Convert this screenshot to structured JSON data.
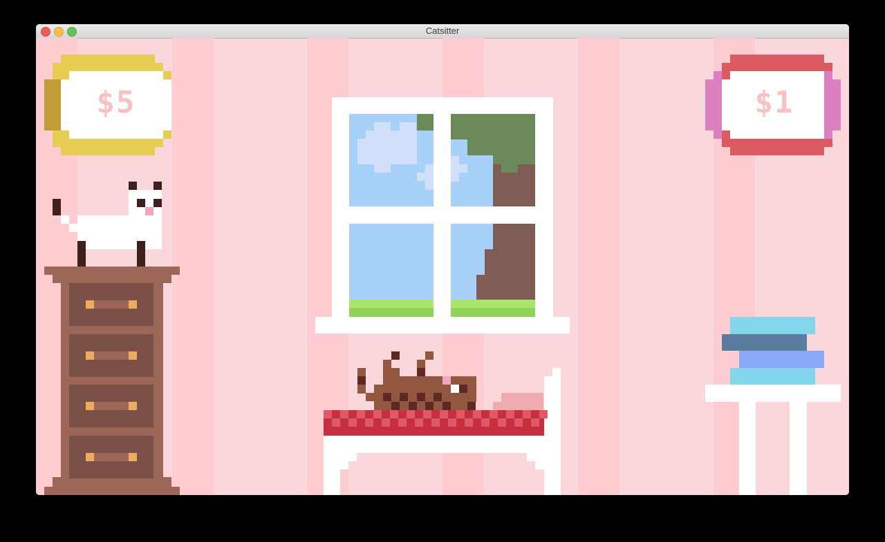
{
  "app": {
    "title": "Catsitter"
  },
  "prices": {
    "left": "$5",
    "right": "$1"
  },
  "colors": {
    "wall": "#f9d7da",
    "wall_stripe": "#fdcdd2",
    "gold": "#e6ce55",
    "gold_dark": "#c19d35",
    "red_frame": "#dc5a62",
    "pink_frame": "#db81bf",
    "dresser": "#9c6658",
    "drawer": "#7b5147",
    "handle": "#efab61",
    "sky": "#a7d1f9",
    "grass": "#8fd35a",
    "tree_trunk": "#7f5d54",
    "tree_leaves": "#6c8a59",
    "blanket": "#c62f3f"
  },
  "icons": {
    "white_cat": "pixel-cat-icon",
    "brown_cat": "pixel-sleeping-cat-icon",
    "books": "book-stack-icon"
  }
}
